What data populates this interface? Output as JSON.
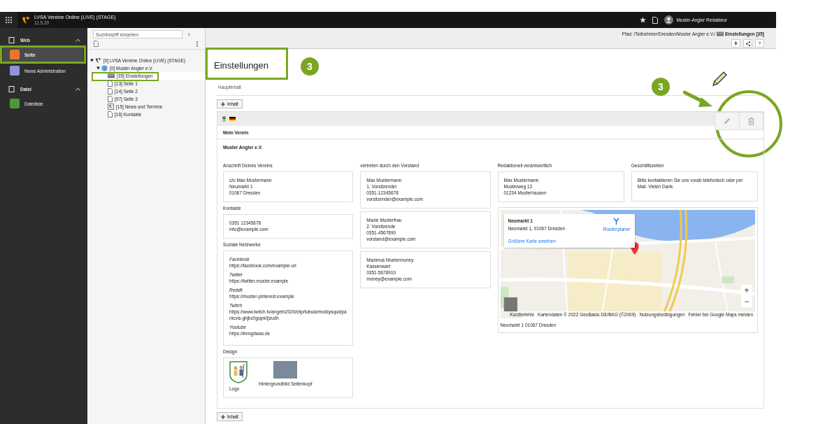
{
  "topbar": {
    "title": "LVSA Vereine Online (LIVE) (STAGE)",
    "version": "11.5.20",
    "user": "Muster-Angler Redakteur"
  },
  "module_groups": [
    {
      "label": "Web",
      "expanded": true,
      "modules": [
        {
          "label": "Seite",
          "selected": true,
          "color": "#e8772e"
        },
        {
          "label": "News Administration",
          "selected": false,
          "color": "#8f93dc"
        }
      ]
    },
    {
      "label": "Datei",
      "expanded": true,
      "modules": [
        {
          "label": "Dateiliste",
          "selected": false,
          "color": "#4c9a3c"
        }
      ]
    }
  ],
  "page_tree": {
    "search": {
      "placeholder": "Suchbegriff eingeben"
    },
    "collapse": "‹",
    "nodes": [
      {
        "label": "[0] LVSA Vereine Online (LIVE) (STAGE)",
        "kind": "root",
        "expanded": true,
        "selected": false,
        "children": [
          {
            "label": "[0] Muster Angler e.V.",
            "kind": "site",
            "expanded": true,
            "selected": false,
            "children": [
              {
                "label": "[35] Einstellungen",
                "kind": "folder",
                "selected": true
              },
              {
                "label": "[13] Seite 1",
                "kind": "page",
                "selected": false
              },
              {
                "label": "[14] Seite 2",
                "kind": "page",
                "selected": false
              },
              {
                "label": "[97] Seite 3",
                "kind": "page",
                "selected": false
              },
              {
                "label": "[15] News und Termine",
                "kind": "news",
                "selected": false
              },
              {
                "label": "[16] Kontakte",
                "kind": "page",
                "selected": false
              }
            ]
          }
        ]
      }
    ]
  },
  "docheader": {
    "path": "Pfad: /Teilnehmer/Dresden/Muster Angler e.V./",
    "page": "Einstellungen [35]",
    "help": "?"
  },
  "page_title": "Einstellungen",
  "annotation_badges": [
    "3",
    "3"
  ],
  "column_label": "Hauptinhalt",
  "add_button_top": "Inhalt",
  "element": {
    "header": "Mein Verein",
    "name": "Muster Angler e.V.",
    "left_column": [
      {
        "kind": "lines",
        "heading": "Anschrift Deines Vereins",
        "cards": [
          [
            "c/o Max Mustermann",
            "Neumarkt 1",
            "01067 Dresden"
          ]
        ]
      },
      {
        "kind": "lines",
        "heading": "Kontakte",
        "cards": [
          [
            "0351 12345678",
            "info@example.com"
          ]
        ]
      },
      {
        "kind": "social",
        "heading": "Soziale Netzwerke",
        "entries": [
          {
            "network": "Facebook",
            "url": "https://facebook.com/example-url"
          },
          {
            "network": "Twitter",
            "url": "https://twitter.muster.example"
          },
          {
            "network": "Reddit",
            "url": "https://muster-pinterest.example"
          },
          {
            "network": "Twitch",
            "url": "https://www.twitch.tv/angeln2020/clip/tubularmoldysquidpanicvis-ghjbz0gupk0jzudh"
          },
          {
            "network": "Youtube",
            "url": "https://irengdwas.de"
          }
        ]
      },
      {
        "kind": "images",
        "heading": "Design",
        "images": [
          {
            "kind": "logo",
            "caption": "Logo"
          },
          {
            "kind": "photo",
            "caption": "Hintergrundbild Seitenkopf"
          }
        ]
      }
    ],
    "middle_column": [
      {
        "kind": "lines",
        "heading": "vertreten durch den Vorstand",
        "cards": [
          [
            "Max Mustermann",
            "1. Vorsitzender",
            "0351-12345678",
            "vorsitzender@example.com"
          ],
          [
            "Maxie Musterfrau",
            "2. Vorsitzende",
            "0351-4567890",
            "vorstand@example.com"
          ],
          [
            "Maximus Mustermoney",
            "Kassenwart",
            "0351-5678910",
            "money@example.com"
          ]
        ]
      }
    ],
    "right_top": [
      {
        "kind": "lines",
        "heading": "Redaktionell verantwortlich",
        "cards": [
          [
            "Max Mustermann",
            "Musterweg 12",
            "01234 Musterhausen"
          ]
        ]
      },
      {
        "kind": "text",
        "heading": "Geschäftszeiten",
        "text": "Bitte kontaktieren Sie uns vorab telefonisch oder per Mail. Vielen Dank."
      }
    ],
    "map": {
      "title": "Neumarkt 1",
      "address": "Neumarkt 1, 01067 Dresden",
      "route": "Routenplaner",
      "larger": "Größere Karte ansehen",
      "zoom_in": "+",
      "zoom_out": "−",
      "footer": [
        "Kurzbefehle",
        "Kartendaten © 2022 GeoBasis-DE/BKG (©2009)",
        "Nutzungsbedingungen",
        "Fehler bei Google Maps melden"
      ],
      "caption": "Neumarkt 1 01067 Dresden"
    }
  },
  "add_button_bottom": "Inhalt"
}
